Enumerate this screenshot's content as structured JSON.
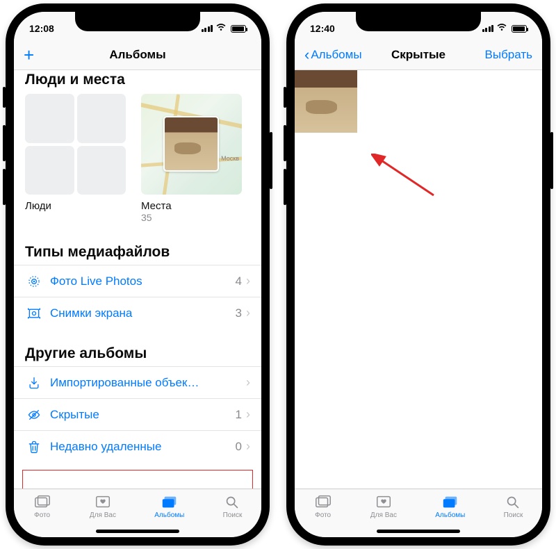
{
  "left": {
    "status": {
      "time": "12:08"
    },
    "nav": {
      "title": "Альбомы"
    },
    "section_cut_title": "Люди и места",
    "cards": {
      "people": {
        "label": "Люди"
      },
      "places": {
        "label": "Места",
        "count": "35",
        "map_city": "Москв"
      }
    },
    "section_media_title": "Типы медиафайлов",
    "media_rows": {
      "live_photos": {
        "label": "Фото Live Photos",
        "count": "4"
      },
      "screenshots": {
        "label": "Снимки экрана",
        "count": "3"
      }
    },
    "section_other_title": "Другие альбомы",
    "other_rows": {
      "imported": {
        "label": "Импортированные объек…"
      },
      "hidden": {
        "label": "Скрытые",
        "count": "1"
      },
      "deleted": {
        "label": "Недавно удаленные",
        "count": "0"
      }
    },
    "tabs": {
      "photos": "Фото",
      "foryou": "Для Вас",
      "albums": "Альбомы",
      "search": "Поиск"
    }
  },
  "right": {
    "status": {
      "time": "12:40"
    },
    "nav": {
      "back": "Альбомы",
      "title": "Скрытые",
      "select": "Выбрать"
    },
    "tabs": {
      "photos": "Фото",
      "foryou": "Для Вас",
      "albums": "Альбомы",
      "search": "Поиск"
    }
  }
}
